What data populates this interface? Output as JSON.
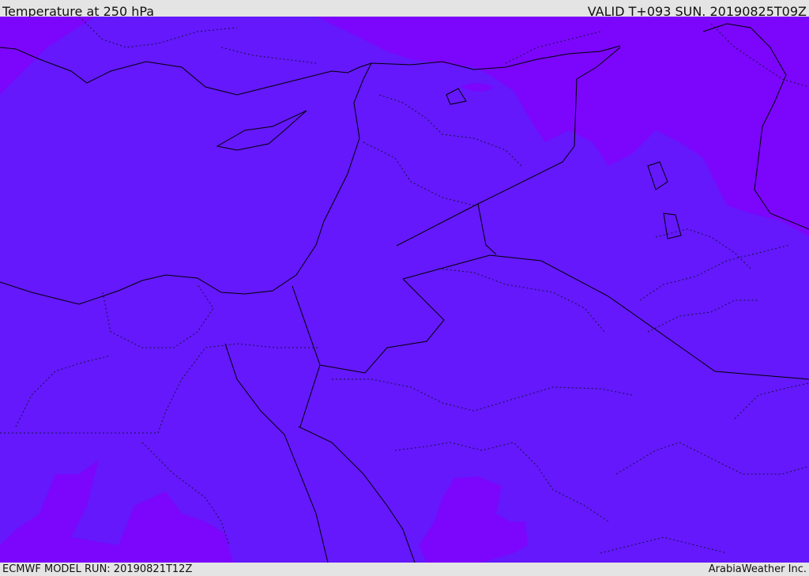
{
  "header": {
    "title": "Temperature at 250 hPa",
    "valid": "VALID T+093 SUN. 20190825T09Z"
  },
  "footer": {
    "model_run": "ECMWF MODEL RUN: 20190821T12Z",
    "credit": "ArabiaWeather Inc."
  },
  "colors": {
    "base_fill": "#6418fb",
    "warm_fill": "#7b06fb",
    "border_line": "#000000",
    "background": "#e4e4e4"
  }
}
